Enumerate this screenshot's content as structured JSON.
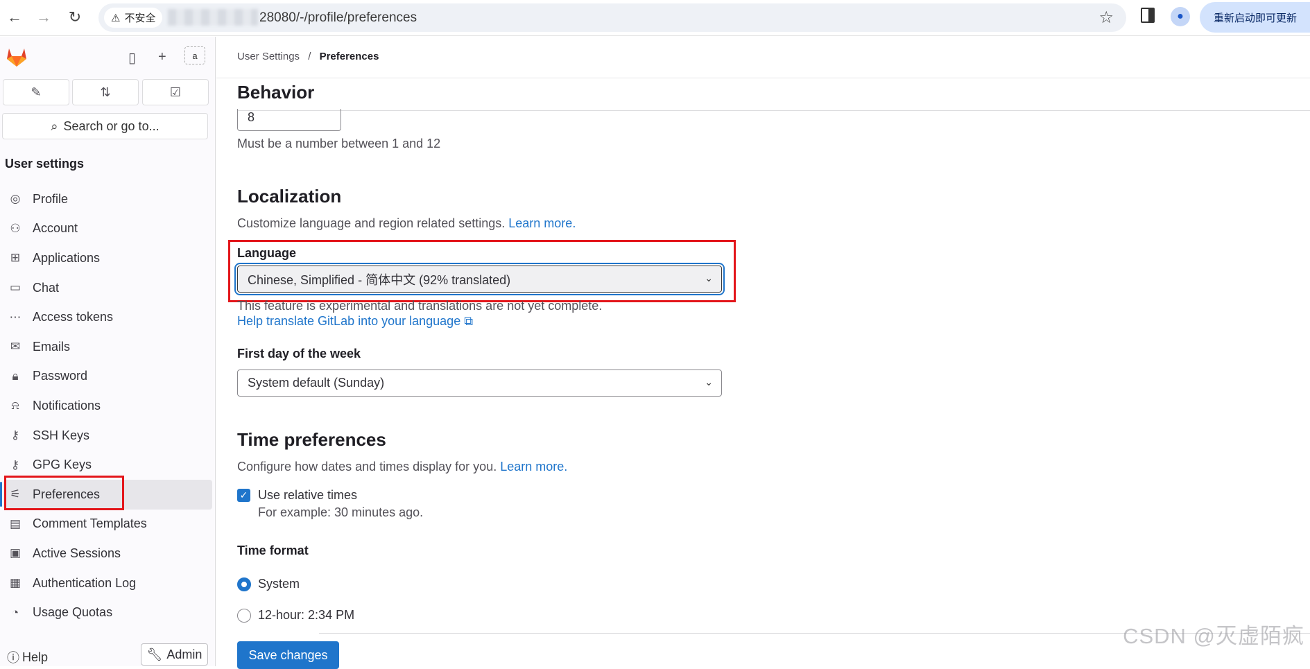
{
  "browser": {
    "security_label": "不安全",
    "url": "28080/-/profile/preferences",
    "relaunch_label": "重新启动即可更新"
  },
  "sidebar": {
    "avatar_alt": "a",
    "search_placeholder": "Search or go to...",
    "section_title": "User settings",
    "items": [
      {
        "label": "Profile",
        "icon": "profile-icon"
      },
      {
        "label": "Account",
        "icon": "account-icon"
      },
      {
        "label": "Applications",
        "icon": "applications-icon"
      },
      {
        "label": "Chat",
        "icon": "chat-icon"
      },
      {
        "label": "Access tokens",
        "icon": "token-icon"
      },
      {
        "label": "Emails",
        "icon": "mail-icon"
      },
      {
        "label": "Password",
        "icon": "lock-icon"
      },
      {
        "label": "Notifications",
        "icon": "bell-icon"
      },
      {
        "label": "SSH Keys",
        "icon": "key-icon"
      },
      {
        "label": "GPG Keys",
        "icon": "key-icon"
      },
      {
        "label": "Preferences",
        "icon": "preferences-icon",
        "active": true
      },
      {
        "label": "Comment Templates",
        "icon": "comment-icon"
      },
      {
        "label": "Active Sessions",
        "icon": "monitor-icon"
      },
      {
        "label": "Authentication Log",
        "icon": "log-icon"
      },
      {
        "label": "Usage Quotas",
        "icon": "quota-icon"
      }
    ],
    "help_label": "Help",
    "admin_label": "Admin"
  },
  "breadcrumb": {
    "parent": "User Settings",
    "separator": "/",
    "current": "Preferences"
  },
  "behavior": {
    "title": "Behavior",
    "number_value": "8",
    "number_hint": "Must be a number between 1 and 12"
  },
  "localization": {
    "title": "Localization",
    "description": "Customize language and region related settings.",
    "learn_more": "Learn more.",
    "language_label": "Language",
    "language_value": "Chinese, Simplified - 简体中文 (92% translated)",
    "experimental_note": "This feature is experimental and translations are not yet complete.",
    "help_translate": "Help translate GitLab into your language",
    "first_day_label": "First day of the week",
    "first_day_value": "System default (Sunday)"
  },
  "time_preferences": {
    "title": "Time preferences",
    "description": "Configure how dates and times display for you.",
    "learn_more": "Learn more.",
    "relative_label": "Use relative times",
    "relative_checked": true,
    "relative_example": "For example: 30 minutes ago.",
    "format_label": "Time format",
    "format_options": [
      {
        "label": "System",
        "selected": true
      },
      {
        "label": "12-hour: 2:34 PM",
        "selected": false
      }
    ]
  },
  "save_label": "Save changes",
  "watermark": "CSDN @灭虚陌疯",
  "colors": {
    "accent": "#1f75cb",
    "highlight": "#e3161b"
  }
}
